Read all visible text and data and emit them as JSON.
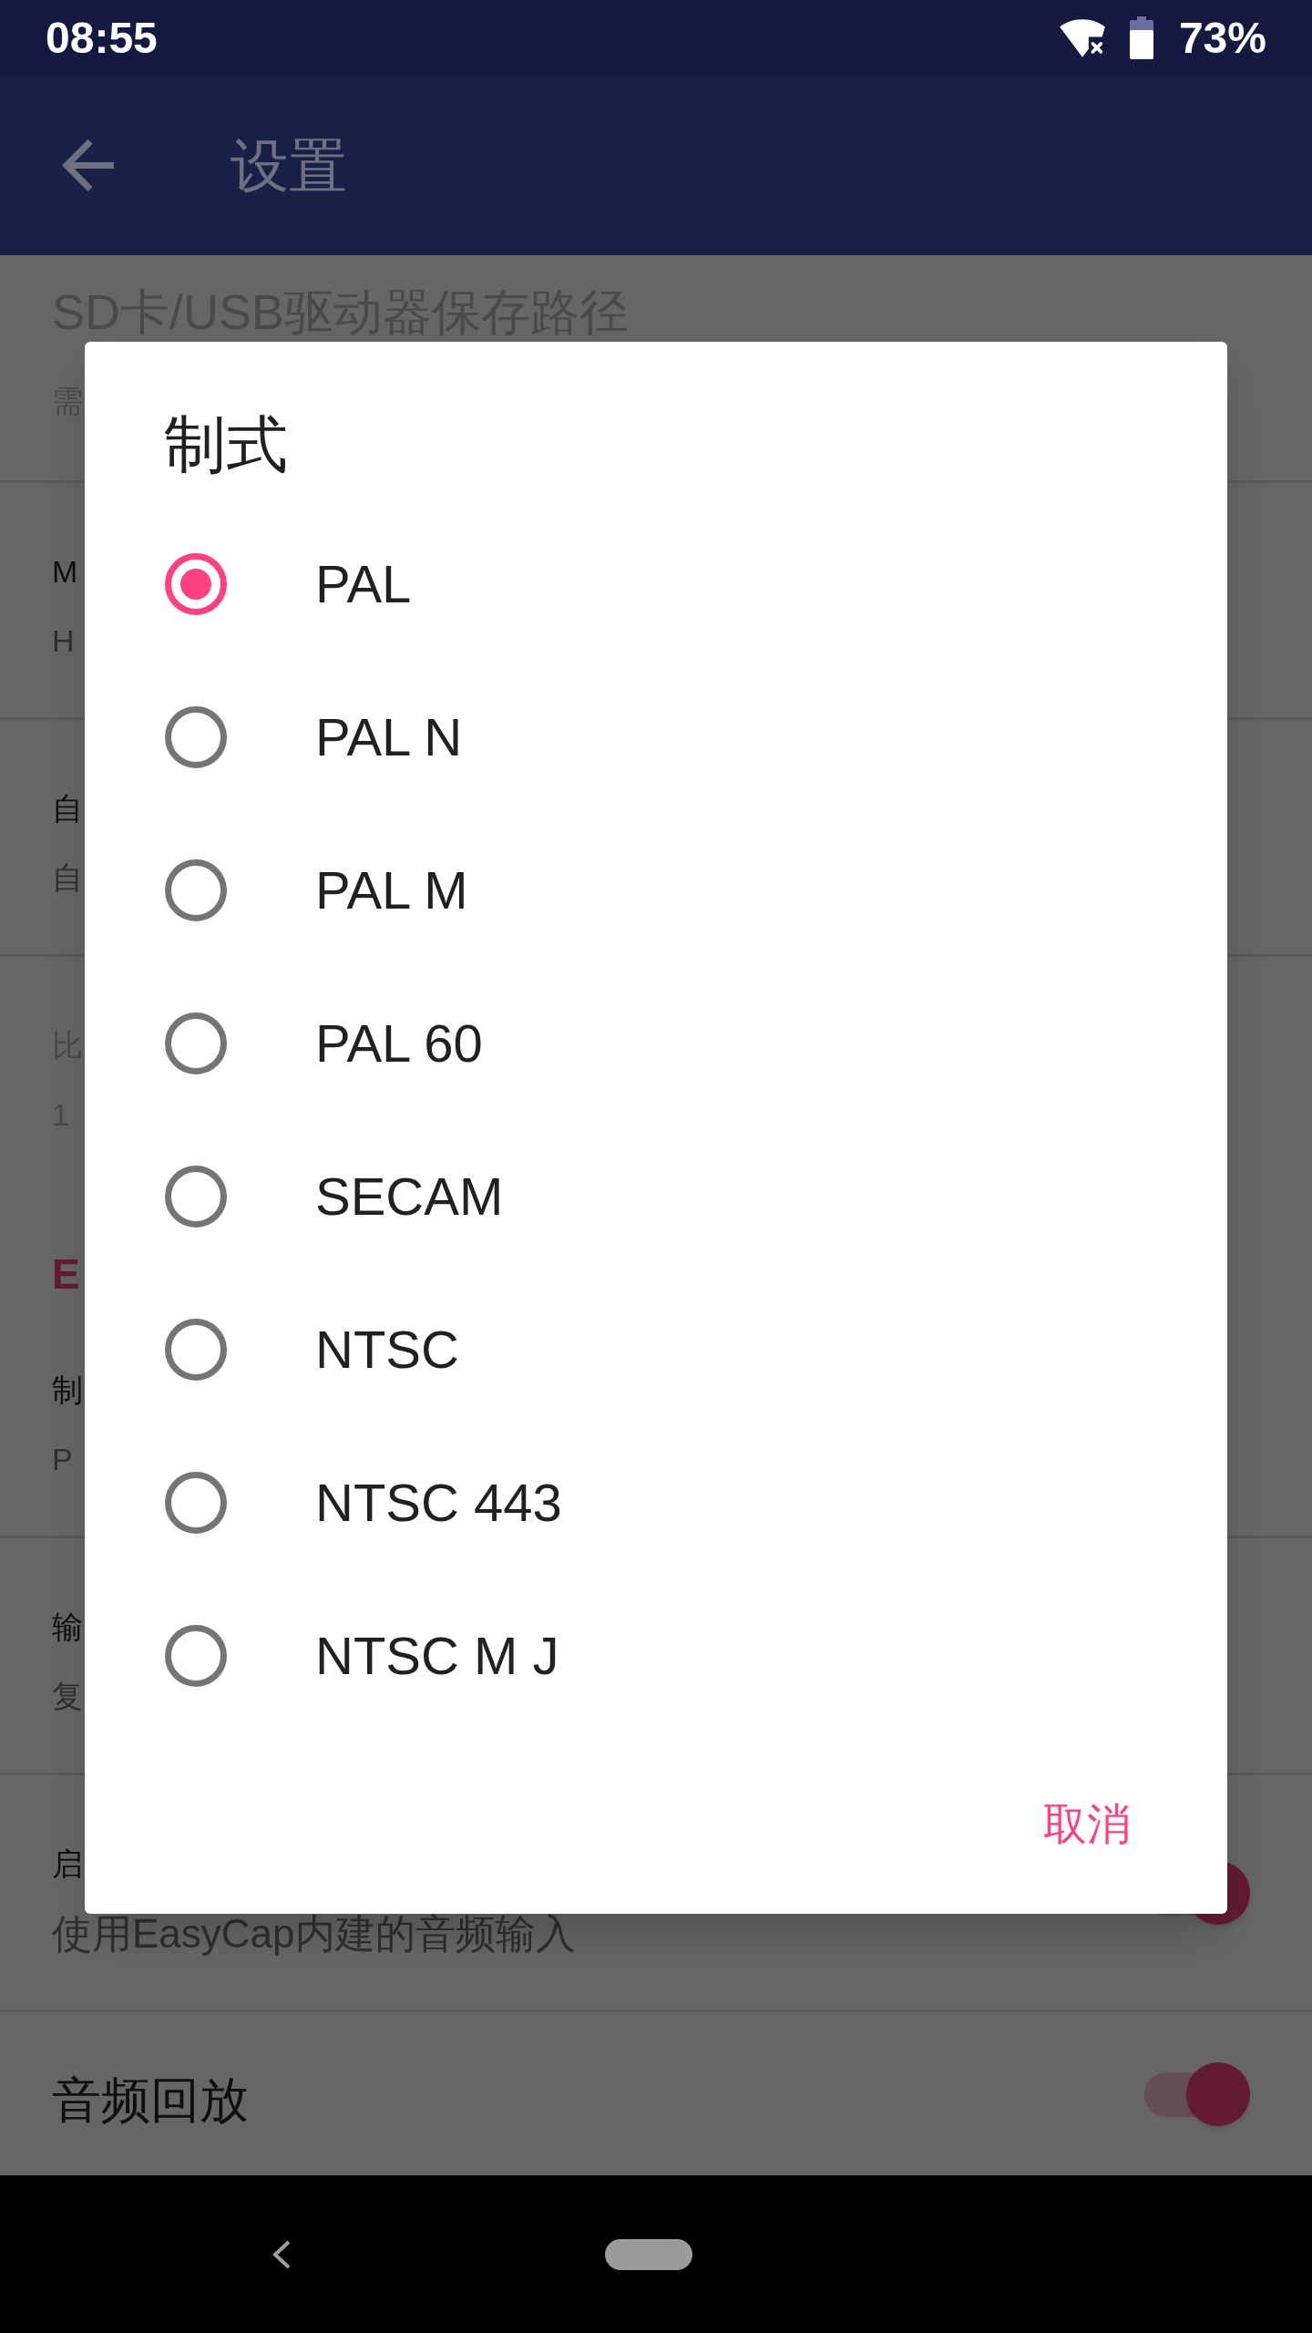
{
  "status_bar": {
    "time": "08:55",
    "battery": "73%"
  },
  "app_bar": {
    "title": "设置"
  },
  "settings": [
    {
      "kind": "item",
      "title": "SD卡/USB驱动器保存路径",
      "subtitle": "需",
      "disabled": true
    },
    {
      "kind": "item",
      "title": "M",
      "subtitle": "H",
      "disabled": false
    },
    {
      "kind": "item",
      "title": "自",
      "subtitle": "自",
      "disabled": false
    },
    {
      "kind": "item",
      "title": "比",
      "subtitle": "1",
      "disabled": true
    },
    {
      "kind": "category",
      "title": "E"
    },
    {
      "kind": "item",
      "title": "制",
      "subtitle": "P",
      "disabled": false
    },
    {
      "kind": "item",
      "title": "输",
      "subtitle": "复",
      "disabled": false
    },
    {
      "kind": "item",
      "title": "启",
      "subtitle": "使用EasyCap内建的音频输入",
      "disabled": false,
      "on": true
    },
    {
      "kind": "item",
      "title": "音频回放",
      "disabled": false,
      "on": true
    }
  ],
  "dialog": {
    "title": "制式",
    "options": [
      {
        "label": "PAL",
        "selected": true
      },
      {
        "label": "PAL N",
        "selected": false
      },
      {
        "label": "PAL M",
        "selected": false
      },
      {
        "label": "PAL 60",
        "selected": false
      },
      {
        "label": "SECAM",
        "selected": false
      },
      {
        "label": "NTSC",
        "selected": false
      },
      {
        "label": "NTSC 443",
        "selected": false
      },
      {
        "label": "NTSC M J",
        "selected": false
      }
    ],
    "buttons": [
      "取消"
    ]
  }
}
